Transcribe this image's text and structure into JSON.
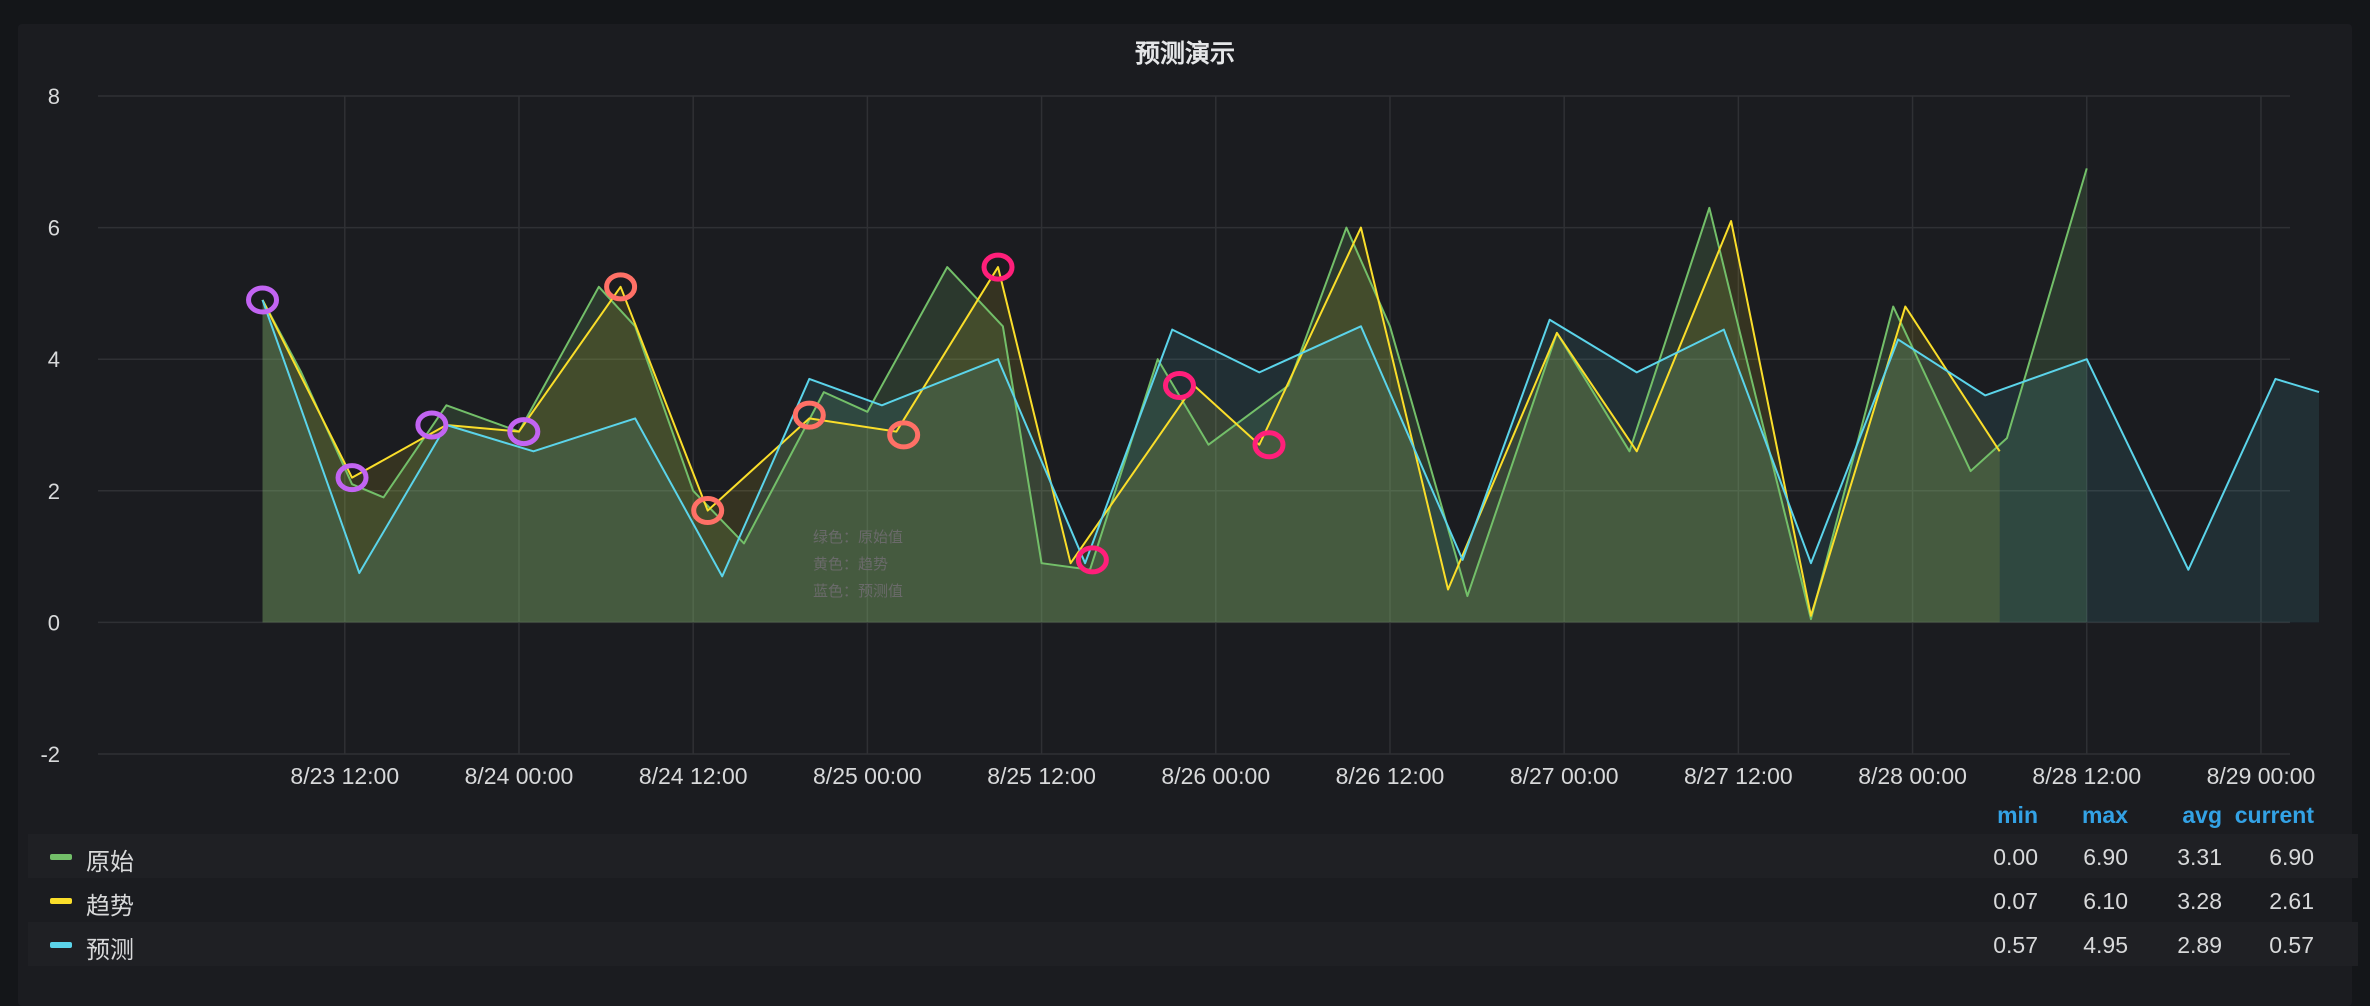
{
  "panel": {
    "title": "预测演示"
  },
  "annotation_lines": [
    "绿色：原始值",
    "黄色：趋势",
    "蓝色：预测值"
  ],
  "legend": {
    "headers": {
      "min": "min",
      "max": "max",
      "avg": "avg",
      "current": "current"
    },
    "rows": [
      {
        "name": "原始",
        "color": "#73bf69",
        "min": "0.00",
        "max": "6.90",
        "avg": "3.31",
        "current": "6.90"
      },
      {
        "name": "趋势",
        "color": "#fade2a",
        "min": "0.07",
        "max": "6.10",
        "avg": "3.28",
        "current": "2.61"
      },
      {
        "name": "预测",
        "color": "#5bd4ea",
        "min": "0.57",
        "max": "4.95",
        "avg": "2.89",
        "current": "0.57"
      }
    ]
  },
  "chart_data": {
    "type": "line",
    "title": "预测演示",
    "xlim_hours": "2023-08-22T19:00 to 2023-08-29T02:00",
    "x_ticks": [
      "8/23 12:00",
      "8/24 00:00",
      "8/24 12:00",
      "8/25 00:00",
      "8/25 12:00",
      "8/26 00:00",
      "8/26 12:00",
      "8/27 00:00",
      "8/27 12:00",
      "8/28 00:00",
      "8/28 12:00",
      "8/29 00:00"
    ],
    "y_ticks": [
      "8",
      "6",
      "4",
      "2",
      "0",
      "-2"
    ],
    "ylim": [
      -2,
      8
    ],
    "grid": true,
    "series": [
      {
        "name": "原始",
        "color": "#73bf69",
        "x": [
          "8/23 06:20",
          "8/23 09:00",
          "8/23 12:30",
          "8/23 14:40",
          "8/23 19:00",
          "8/24 00:00",
          "8/24 05:30",
          "8/24 08:00",
          "8/24 12:00",
          "8/24 15:30",
          "8/24 21:00",
          "8/25 00:00",
          "8/25 05:30",
          "8/25 09:20",
          "8/25 12:00",
          "8/25 15:20",
          "8/25 20:00",
          "8/25 23:30",
          "8/26 05:00",
          "8/26 09:00",
          "8/26 12:00",
          "8/26 17:20",
          "8/26 23:30",
          "8/27 04:30",
          "8/27 10:00",
          "8/27 12:00",
          "8/27 17:00",
          "8/27 22:40",
          "8/28 04:00",
          "8/28 06:30",
          "8/28 12:00"
        ],
        "values": [
          4.9,
          3.8,
          2.1,
          1.9,
          3.3,
          2.9,
          5.1,
          4.5,
          2.0,
          1.2,
          3.5,
          3.2,
          5.4,
          4.5,
          0.9,
          0.8,
          4.0,
          2.7,
          3.6,
          6.0,
          4.5,
          0.4,
          4.4,
          2.6,
          6.3,
          4.5,
          0.05,
          4.8,
          2.3,
          2.8,
          6.9
        ]
      },
      {
        "name": "趋势",
        "color": "#fade2a",
        "x": [
          "8/23 06:20",
          "8/23 12:30",
          "8/23 19:00",
          "8/24 00:00",
          "8/24 07:00",
          "8/24 13:00",
          "8/24 20:00",
          "8/25 02:00",
          "8/25 09:00",
          "8/25 14:00",
          "8/25 22:30",
          "8/26 03:00",
          "8/26 10:00",
          "8/26 16:00",
          "8/26 23:30",
          "8/27 05:00",
          "8/27 11:30",
          "8/27 17:00",
          "8/27 23:30",
          "8/28 06:00"
        ],
        "values": [
          4.9,
          2.2,
          3.0,
          2.9,
          5.1,
          1.7,
          3.1,
          2.9,
          5.4,
          0.9,
          3.6,
          2.7,
          6.0,
          0.5,
          4.4,
          2.6,
          6.1,
          0.1,
          4.8,
          2.6
        ]
      },
      {
        "name": "预测",
        "color": "#5bd4ea",
        "x": [
          "8/23 06:20",
          "8/23 13:00",
          "8/23 19:00",
          "8/24 01:00",
          "8/24 08:00",
          "8/24 14:00",
          "8/24 20:00",
          "8/25 01:00",
          "8/25 09:00",
          "8/25 15:00",
          "8/25 21:00",
          "8/26 03:00",
          "8/26 10:00",
          "8/26 17:00",
          "8/26 23:00",
          "8/27 05:00",
          "8/27 11:00",
          "8/27 17:00",
          "8/27 23:00",
          "8/28 05:00",
          "8/28 12:00",
          "8/28 19:00",
          "8/29 01:00",
          "8/29 04:00"
        ],
        "values": [
          4.9,
          0.75,
          3.0,
          2.6,
          3.1,
          0.7,
          3.7,
          3.3,
          4.0,
          0.9,
          4.45,
          3.8,
          4.5,
          0.95,
          4.6,
          3.8,
          4.45,
          0.9,
          4.3,
          3.45,
          4.0,
          0.8,
          3.7,
          3.5
        ]
      }
    ],
    "markers": [
      {
        "x": "8/23 06:20",
        "y": 4.9,
        "color": "#c264f2"
      },
      {
        "x": "8/23 12:30",
        "y": 2.2,
        "color": "#c264f2"
      },
      {
        "x": "8/23 18:00",
        "y": 3.0,
        "color": "#c264f2"
      },
      {
        "x": "8/24 00:20",
        "y": 2.9,
        "color": "#c264f2"
      },
      {
        "x": "8/24 07:00",
        "y": 5.1,
        "color": "#ff7066"
      },
      {
        "x": "8/24 13:00",
        "y": 1.7,
        "color": "#ff7066"
      },
      {
        "x": "8/24 20:00",
        "y": 3.15,
        "color": "#ff7066"
      },
      {
        "x": "8/25 02:30",
        "y": 2.85,
        "color": "#ff7066"
      },
      {
        "x": "8/25 09:00",
        "y": 5.4,
        "color": "#ff1f7a"
      },
      {
        "x": "8/25 15:30",
        "y": 0.95,
        "color": "#ff1f7a"
      },
      {
        "x": "8/25 21:30",
        "y": 3.6,
        "color": "#ff1f7a"
      },
      {
        "x": "8/26 03:40",
        "y": 2.7,
        "color": "#ff1f7a"
      }
    ]
  }
}
